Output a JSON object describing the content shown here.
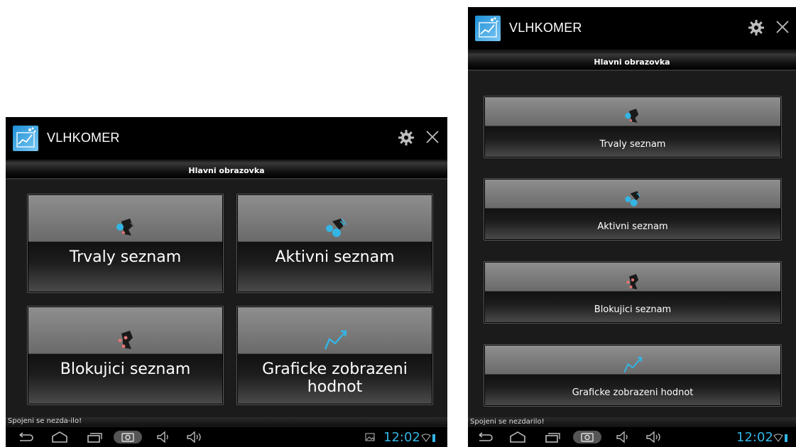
{
  "app": {
    "title": "VLHKOMER",
    "subtitle": "Hlavni obrazovka",
    "status_message": "Spojeni se nezdarilo!",
    "clock": "12:02",
    "accent_color": "#33b5e5"
  },
  "landscape": {
    "buttons": [
      {
        "label": "Trvaly seznam",
        "icon": "bluetooth-devices-icon"
      },
      {
        "label": "Aktivni seznam",
        "icon": "bluetooth-active-icon"
      },
      {
        "label": "Blokujici seznam",
        "icon": "bluetooth-blocked-icon"
      },
      {
        "label": "Graficke zobrazeni hodnot",
        "icon": "trend-chart-icon"
      }
    ],
    "status_message": "Spojeni se nezda-ilo!"
  },
  "portrait": {
    "buttons": [
      {
        "label": "Trvaly seznam",
        "icon": "bluetooth-devices-icon"
      },
      {
        "label": "Aktivni seznam",
        "icon": "bluetooth-active-icon"
      },
      {
        "label": "Blokujici seznam",
        "icon": "bluetooth-blocked-icon"
      },
      {
        "label": "Graficke zobrazeni hodnot",
        "icon": "trend-chart-icon"
      }
    ]
  },
  "navigation": {
    "icons": [
      "back-icon",
      "home-icon",
      "recent-apps-icon",
      "screenshot-icon",
      "volume-down-icon",
      "volume-up-icon"
    ]
  }
}
